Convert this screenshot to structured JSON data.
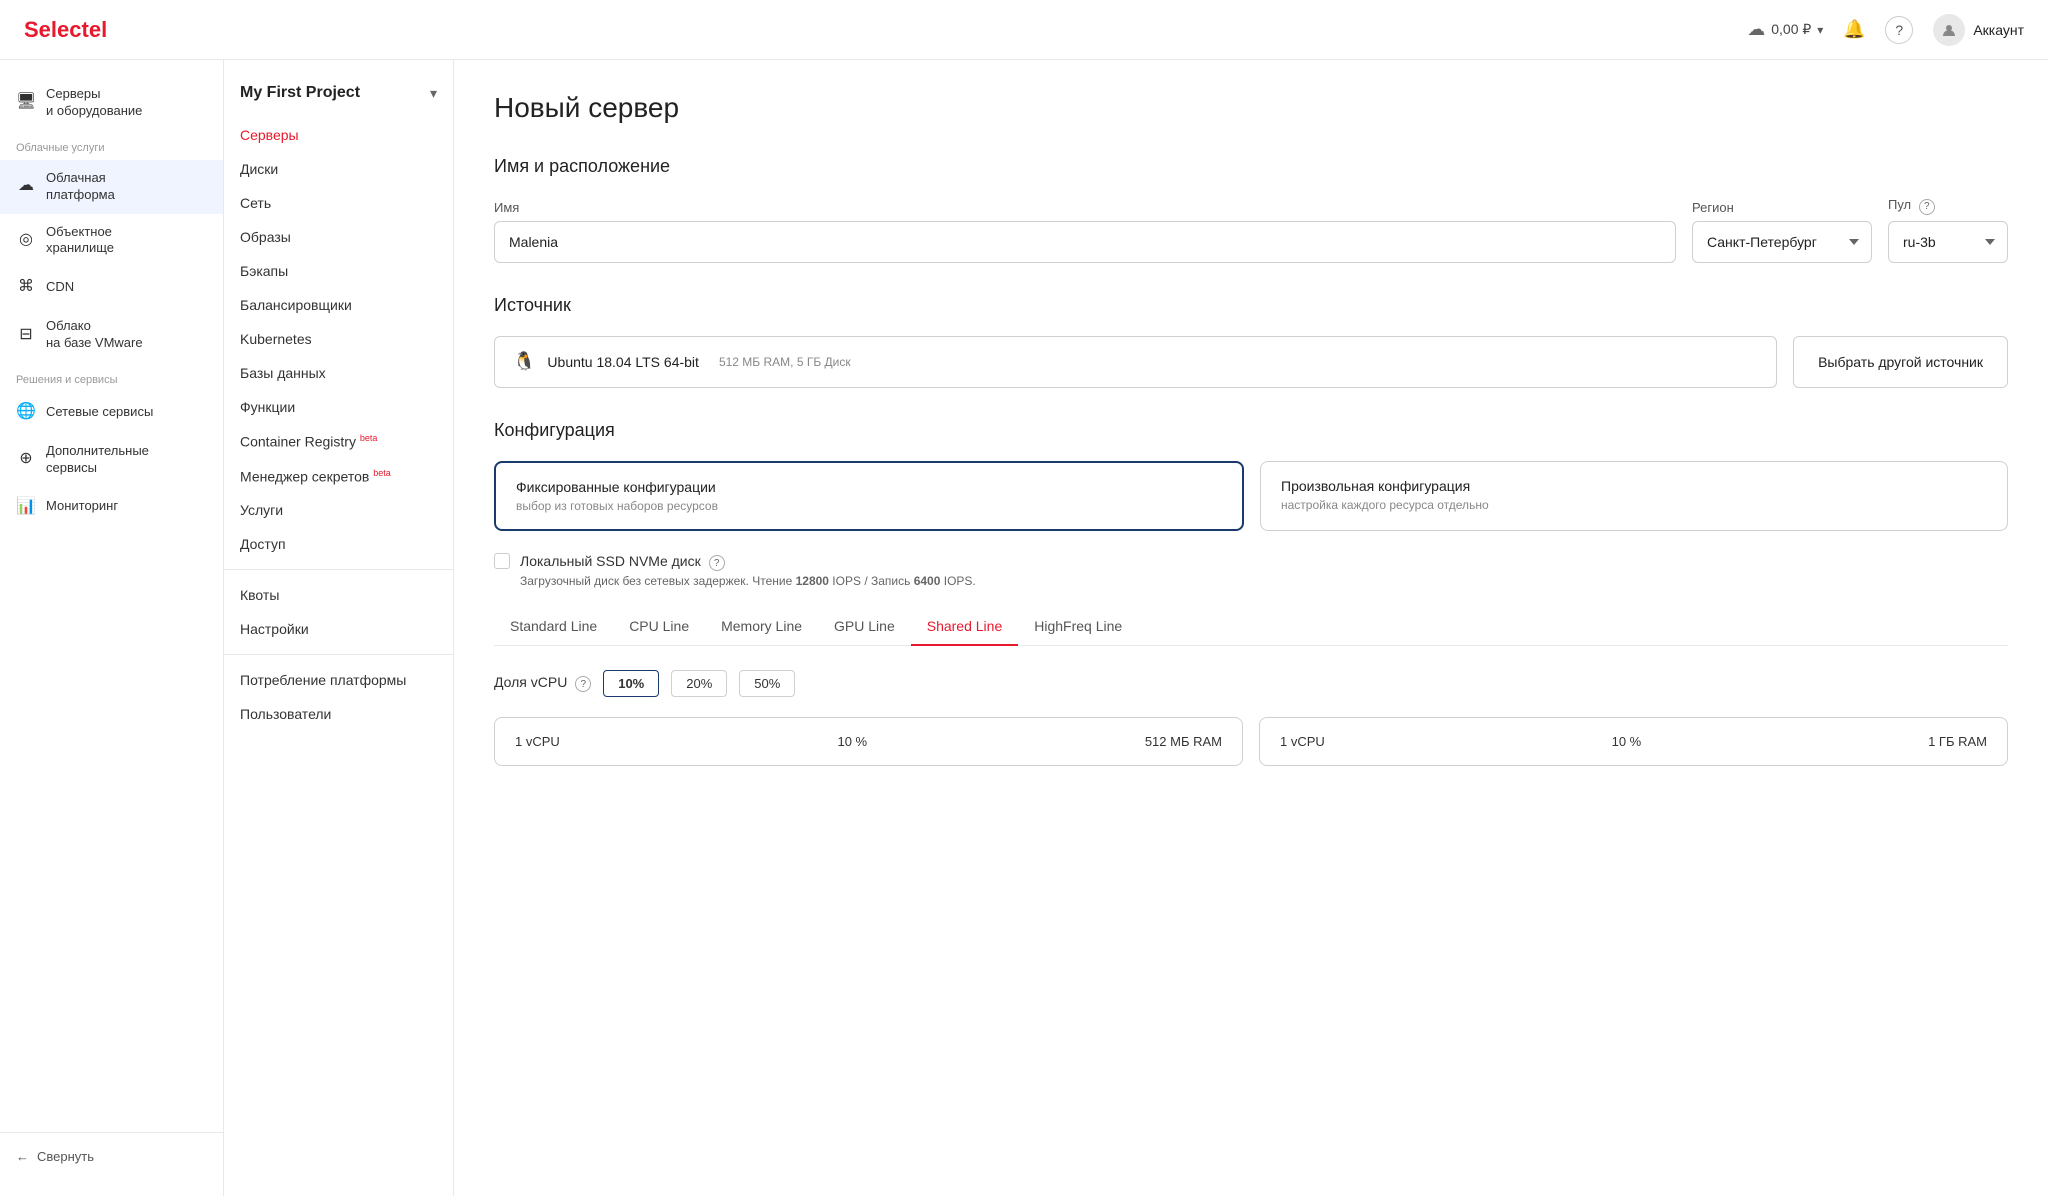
{
  "header": {
    "logo_prefix": "Select",
    "logo_highlight": "el",
    "balance": "0,00 ₽",
    "account_label": "Аккаунт"
  },
  "sidebar_left": {
    "sections": [
      {
        "label": "",
        "items": [
          {
            "id": "servers",
            "icon": "🖥",
            "label": "Серверы\nи оборудование"
          }
        ]
      },
      {
        "label": "Облачные услуги",
        "items": [
          {
            "id": "cloud",
            "icon": "☁",
            "label": "Облачная\nплатформа",
            "active": true
          },
          {
            "id": "object",
            "icon": "◎",
            "label": "Объектное\nхранилище"
          },
          {
            "id": "cdn",
            "icon": "⌘",
            "label": "CDN"
          },
          {
            "id": "vmware",
            "icon": "⊟",
            "label": "Облако\nна базе VMware"
          }
        ]
      },
      {
        "label": "Решения и сервисы",
        "items": [
          {
            "id": "network",
            "icon": "🌐",
            "label": "Сетевые сервисы"
          },
          {
            "id": "extra",
            "icon": "⊕",
            "label": "Дополнительные\nсервисы"
          },
          {
            "id": "monitoring",
            "icon": "📊",
            "label": "Мониторинг"
          }
        ]
      }
    ],
    "collapse_label": "Свернуть"
  },
  "sidebar_second": {
    "project_name": "My First Project",
    "nav_items": [
      {
        "id": "servers",
        "label": "Серверы",
        "active": true
      },
      {
        "id": "disks",
        "label": "Диски"
      },
      {
        "id": "network",
        "label": "Сеть"
      },
      {
        "id": "images",
        "label": "Образы"
      },
      {
        "id": "backups",
        "label": "Бэкапы"
      },
      {
        "id": "balancers",
        "label": "Балансировщики"
      },
      {
        "id": "kubernetes",
        "label": "Kubernetes"
      },
      {
        "id": "databases",
        "label": "Базы данных"
      },
      {
        "id": "functions",
        "label": "Функции"
      },
      {
        "id": "registry",
        "label": "Container Registry",
        "badge": "beta"
      },
      {
        "id": "secrets",
        "label": "Менеджер секретов",
        "badge": "beta"
      },
      {
        "id": "services",
        "label": "Услуги"
      },
      {
        "id": "access",
        "label": "Доступ"
      }
    ],
    "bottom_nav": [
      {
        "id": "quotas",
        "label": "Квоты"
      },
      {
        "id": "settings",
        "label": "Настройки"
      }
    ],
    "platform_nav": [
      {
        "id": "platform-usage",
        "label": "Потребление платформы"
      },
      {
        "id": "users",
        "label": "Пользователи"
      }
    ]
  },
  "main": {
    "page_title": "Новый сервер",
    "name_section": {
      "title": "Имя и расположение",
      "name_label": "Имя",
      "name_value": "Malenia",
      "region_label": "Регион",
      "region_value": "Санкт-Петербург",
      "pool_label": "Пул",
      "pool_value": "ru-3b"
    },
    "source_section": {
      "title": "Источник",
      "current_source": "Ubuntu 18.04 LTS 64-bit",
      "current_meta": "512 МБ RAM, 5 ГБ Диск",
      "change_button": "Выбрать другой источник"
    },
    "config_section": {
      "title": "Конфигурация",
      "options": [
        {
          "id": "fixed",
          "title": "Фиксированные конфигурации",
          "desc": "выбор из готовых наборов ресурсов",
          "selected": true
        },
        {
          "id": "custom",
          "title": "Произвольная конфигурация",
          "desc": "настройка каждого ресурса отдельно",
          "selected": false
        }
      ],
      "nvme_label": "Локальный SSD NVMe диск",
      "nvme_desc": "Загрузочный диск без сетевых задержек. Чтение ",
      "nvme_read": "12800",
      "nvme_iops_read": " IOPS / Запись ",
      "nvme_write": "6400",
      "nvme_iops_write": " IOPS."
    },
    "tabs": [
      {
        "id": "standard",
        "label": "Standard Line",
        "active": false
      },
      {
        "id": "cpu",
        "label": "CPU Line",
        "active": false
      },
      {
        "id": "memory",
        "label": "Memory Line",
        "active": false
      },
      {
        "id": "gpu",
        "label": "GPU Line",
        "active": false
      },
      {
        "id": "shared",
        "label": "Shared Line",
        "active": true
      },
      {
        "id": "highfreq",
        "label": "HighFreq Line",
        "active": false
      }
    ],
    "vcpu_section": {
      "label": "Доля vCPU",
      "options": [
        {
          "value": "10%",
          "selected": true
        },
        {
          "value": "20%",
          "selected": false
        },
        {
          "value": "50%",
          "selected": false
        }
      ]
    },
    "server_cards": [
      {
        "vcpu": "1 vCPU",
        "share": "10 %",
        "ram": "512 МБ RAM"
      },
      {
        "vcpu": "1 vCPU",
        "share": "10 %",
        "ram": "1 ГБ RAM"
      }
    ]
  }
}
